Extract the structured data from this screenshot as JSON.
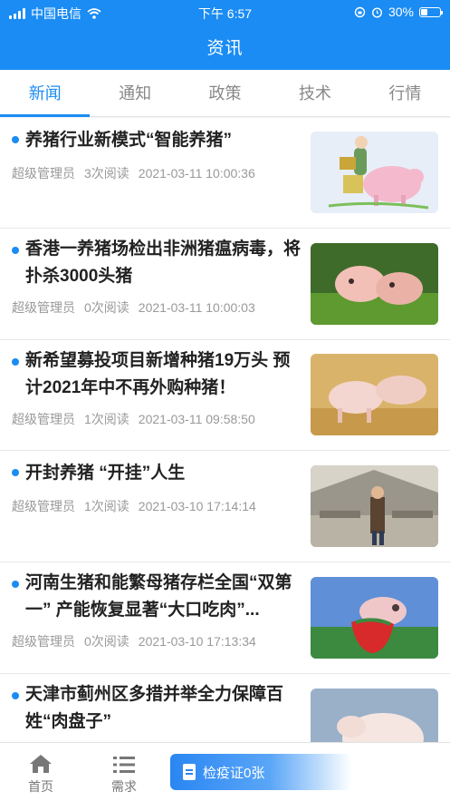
{
  "status_bar": {
    "carrier": "中国电信",
    "time": "下午 6:57",
    "battery": "30%"
  },
  "header": {
    "title": "资讯"
  },
  "tabs": [
    {
      "label": "新闻",
      "active": true
    },
    {
      "label": "通知",
      "active": false
    },
    {
      "label": "政策",
      "active": false
    },
    {
      "label": "技术",
      "active": false
    },
    {
      "label": "行情",
      "active": false
    }
  ],
  "news": [
    {
      "title": "养猪行业新模式“智能养猪”",
      "author": "超级管理员",
      "reads": "3次阅读",
      "time": "2021-03-11 10:00:36",
      "image": "cartoon-farmer-feeding-pig"
    },
    {
      "title": "香港一养猪场检出非洲猪瘟病毒，将扑杀3000头猪",
      "author": "超级管理员",
      "reads": "0次阅读",
      "time": "2021-03-11 10:00:03",
      "image": "piglets-on-grass"
    },
    {
      "title": "新希望募投项目新增种猪19万头 预计2021年中不再外购种猪！",
      "author": "超级管理员",
      "reads": "1次阅读",
      "time": "2021-03-11 09:58:50",
      "image": "pigs-on-straw"
    },
    {
      "title": "开封养猪 “开挂”人生",
      "author": "超级管理员",
      "reads": "1次阅读",
      "time": "2021-03-10 17:14:14",
      "image": "man-in-pig-barn"
    },
    {
      "title": "河南生猪和能繁母猪存栏全国“双第一” 产能恢复显著“大口吃肉”...",
      "author": "超级管理员",
      "reads": "0次阅读",
      "time": "2021-03-10 17:13:34",
      "image": "piglet-with-strawberry"
    },
    {
      "title": "天津市蓟州区多措并举全力保障百姓“肉盘子”",
      "author": "",
      "reads": "",
      "time": "",
      "image": "white-pig"
    }
  ],
  "bottom_nav": {
    "home": "首页",
    "demand": "需求",
    "certificate": "检疫证0张"
  },
  "colors": {
    "primary": "#1a8cf3"
  }
}
